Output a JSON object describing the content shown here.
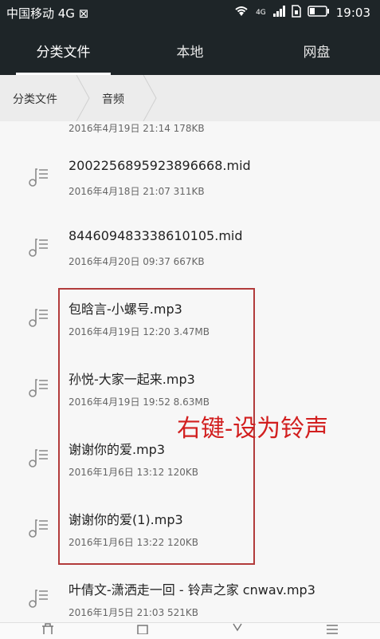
{
  "status_bar": {
    "carrier": "中国移动 4G ⊠",
    "network": "4G",
    "time": "19:03"
  },
  "tabs": [
    {
      "label": "分类文件",
      "active": true
    },
    {
      "label": "本地",
      "active": false
    },
    {
      "label": "网盘",
      "active": false
    }
  ],
  "breadcrumb": [
    {
      "label": "分类文件"
    },
    {
      "label": "音频"
    }
  ],
  "files": [
    {
      "name": "",
      "meta": "2016年4月19日 21:14 178KB"
    },
    {
      "name": "2002256895923896668.mid",
      "meta": "2016年4月18日 21:07 311KB"
    },
    {
      "name": "844609483338610105.mid",
      "meta": "2016年4月20日 09:37 667KB"
    },
    {
      "name": "包晗言-小螺号.mp3",
      "meta": "2016年4月19日 12:20 3.47MB"
    },
    {
      "name": "孙悦-大家一起来.mp3",
      "meta": "2016年4月19日 19:52 8.63MB"
    },
    {
      "name": "谢谢你的爱.mp3",
      "meta": "2016年1月6日 13:12 120KB"
    },
    {
      "name": "谢谢你的爱(1).mp3",
      "meta": "2016年1月6日 13:22 120KB"
    },
    {
      "name": "叶倩文-潇洒走一回 - 铃声之家 cnwav.mp3",
      "meta": "2016年1月5日 21:03 521KB"
    }
  ],
  "annotation": "右键-设为铃声",
  "colors": {
    "header_bg": "#1e2528",
    "annotation": "#d21f1f"
  }
}
